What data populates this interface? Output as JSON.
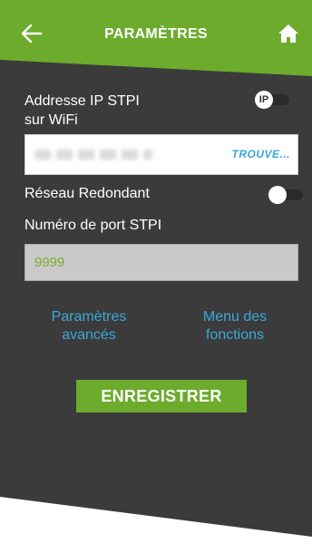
{
  "header": {
    "title": "PARAMÈTRES",
    "back_icon": "arrow-left-icon",
    "home_icon": "home-icon"
  },
  "ip": {
    "label_line1": "Addresse IP STPI",
    "label_line2": "sur WiFi",
    "toggle_text": "IP",
    "toggle_on": false,
    "find_label": "TROUVE..."
  },
  "redundant": {
    "label": "Réseau Redondant",
    "toggle_on": false
  },
  "port": {
    "label": "Numéro de port STPI",
    "value": "9999"
  },
  "links": {
    "advanced_line1": "Paramètres",
    "advanced_line2": "avancés",
    "menu_line1": "Menu des",
    "menu_line2": "fonctions"
  },
  "save_label": "ENREGISTRER",
  "colors": {
    "accent_green": "#6cab2c",
    "dark_panel": "#3b3b3b",
    "link_blue": "#3aa8d8",
    "port_value": "#7dad2d"
  }
}
